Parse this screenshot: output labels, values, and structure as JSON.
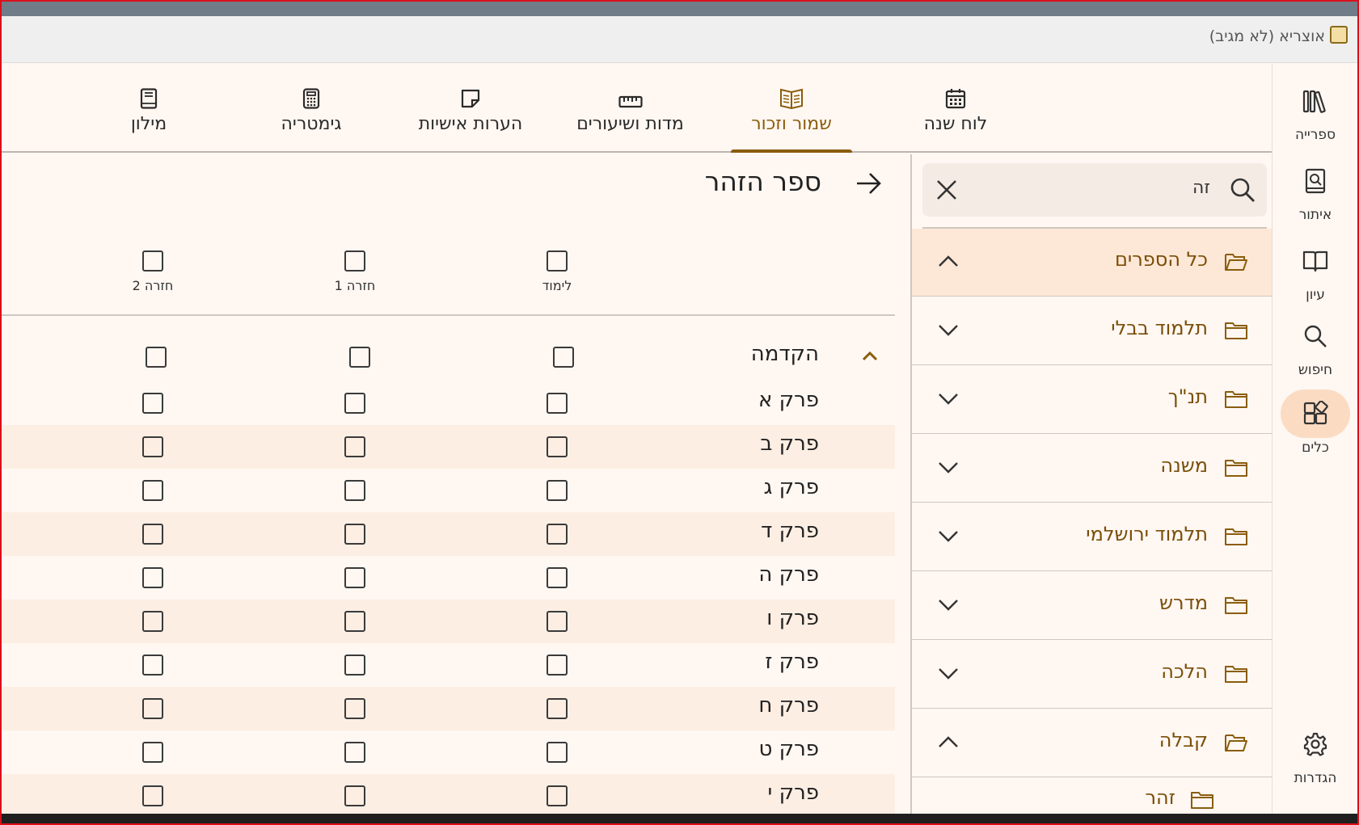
{
  "window": {
    "title": "אוצריא (לא מגיב)"
  },
  "rail": {
    "items": [
      {
        "label": "ספרייה",
        "icon": "library-icon"
      },
      {
        "label": "איתור",
        "icon": "find-book-icon"
      },
      {
        "label": "עיון",
        "icon": "open-book-icon"
      },
      {
        "label": "חיפוש",
        "icon": "search-icon"
      },
      {
        "label": "כלים",
        "icon": "tools-icon",
        "active": true
      }
    ],
    "settings_label": "הגדרות"
  },
  "tabs": [
    {
      "label": "לוח שנה",
      "icon": "calendar-icon"
    },
    {
      "label": "שמור וזכור",
      "icon": "study-tracker-icon",
      "active": true
    },
    {
      "label": "מדות ושיעורים",
      "icon": "ruler-icon"
    },
    {
      "label": "הערות אישיות",
      "icon": "note-icon"
    },
    {
      "label": "גימטריה",
      "icon": "calculator-icon"
    },
    {
      "label": "מילון",
      "icon": "dictionary-icon"
    }
  ],
  "tracker": {
    "book_title": "ספר הזהר",
    "columns": [
      "לימוד",
      "חזרה 1",
      "חזרה 2"
    ],
    "section": "הקדמה",
    "rows": [
      "פרק א",
      "פרק ב",
      "פרק ג",
      "פרק ד",
      "פרק ה",
      "פרק ו",
      "פרק ז",
      "פרק ח",
      "פרק ט",
      "פרק י"
    ]
  },
  "tree": {
    "search_value": "זה",
    "items": [
      {
        "label": "כל הספרים",
        "expanded": true,
        "active": true
      },
      {
        "label": "תלמוד בבלי",
        "expanded": false
      },
      {
        "label": "תנ\"ך",
        "expanded": false
      },
      {
        "label": "משנה",
        "expanded": false
      },
      {
        "label": "תלמוד ירושלמי",
        "expanded": false
      },
      {
        "label": "מדרש",
        "expanded": false
      },
      {
        "label": "הלכה",
        "expanded": false
      },
      {
        "label": "קבלה",
        "expanded": true
      },
      {
        "label": "זהר",
        "expanded": false
      }
    ]
  },
  "colors": {
    "accent": "#8a5d0b",
    "background": "#fff7f2",
    "active_bg": "#fde7d6"
  }
}
